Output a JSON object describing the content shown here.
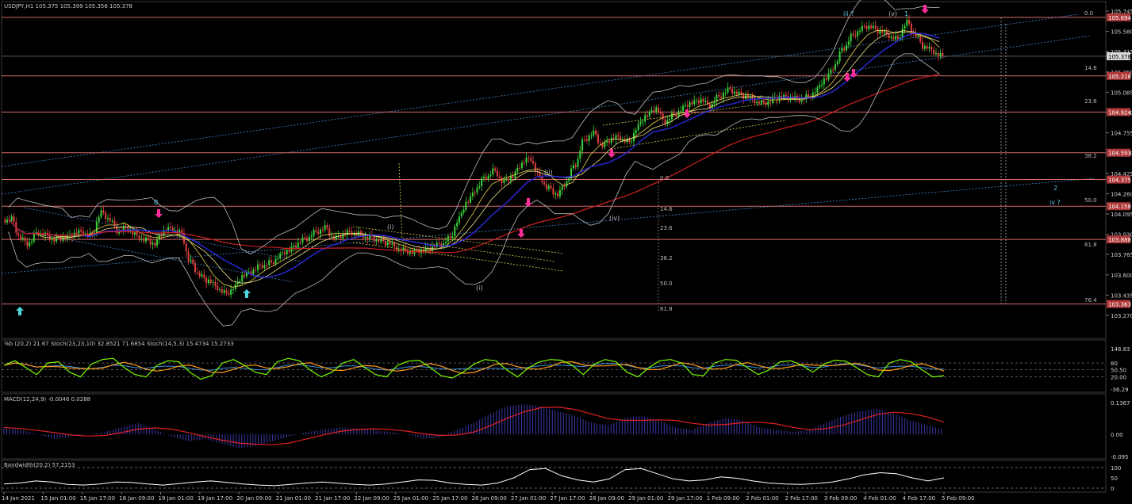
{
  "chart_data": [
    {
      "type": "line",
      "title": "USDJPY,H1  105.375 105.399 105.356 105.378",
      "symbol": "USDJPY,H1",
      "ohlc": [
        "105.375",
        "105.399",
        "105.356",
        "105.378"
      ],
      "ylim": [
        103.27,
        105.745
      ],
      "y_ticks": [
        "105.745",
        "105.580",
        "105.415",
        "105.250",
        "105.085",
        "104.920",
        "104.755",
        "104.590",
        "104.425",
        "104.260",
        "104.095",
        "103.930",
        "103.765",
        "103.600",
        "103.435",
        "103.270"
      ],
      "price_tags": [
        "105.694",
        "105.218",
        "104.924",
        "104.593",
        "104.375",
        "104.158",
        "103.888",
        "103.363"
      ],
      "current_price": "105.378",
      "x_ticks": [
        "14 Jan 2021",
        "15 Jan 01:00",
        "15 Jan 17:00",
        "18 Jan 09:00",
        "19 Jan 01:00",
        "19 Jan 17:00",
        "20 Jan 09:00",
        "21 Jan 01:00",
        "21 Jan 17:00",
        "22 Jan 09:00",
        "25 Jan 01:00",
        "25 Jan 17:00",
        "26 Jan 09:00",
        "27 Jan 01:00",
        "27 Jan 17:00",
        "28 Jan 09:00",
        "29 Jan 01:00",
        "29 Jan 17:00",
        "1 Feb 09:00",
        "2 Feb 01:00",
        "2 Feb 17:00",
        "3 Feb 09:00",
        "4 Feb 01:00",
        "4 Feb 17:00",
        "5 Feb 09:00"
      ],
      "close_series": [
        104.05,
        103.9,
        103.85,
        103.95,
        103.92,
        103.88,
        103.9,
        103.93,
        103.95,
        103.92,
        104.1,
        104.05,
        103.95,
        103.98,
        103.92,
        103.88,
        103.85,
        103.95,
        103.98,
        103.94,
        103.7,
        103.6,
        103.55,
        103.5,
        103.45,
        103.5,
        103.6,
        103.63,
        103.68,
        103.7,
        103.75,
        103.8,
        103.85,
        103.9,
        103.95,
        103.98,
        103.9,
        103.92,
        103.95,
        103.93,
        103.9,
        103.88,
        103.86,
        103.82,
        103.8,
        103.78,
        103.8,
        103.82,
        103.85,
        103.9,
        104.05,
        104.2,
        104.3,
        104.4,
        104.45,
        104.35,
        104.4,
        104.5,
        104.55,
        104.4,
        104.3,
        104.25,
        104.35,
        104.5,
        104.7,
        104.75,
        104.65,
        104.7,
        104.72,
        104.68,
        104.8,
        104.9,
        104.95,
        104.85,
        104.9,
        104.95,
        105.0,
        105.02,
        104.98,
        105.05,
        105.1,
        105.08,
        105.05,
        105.02,
        105.0,
        105.02,
        105.05,
        105.04,
        105.03,
        105.05,
        105.1,
        105.2,
        105.3,
        105.45,
        105.55,
        105.6,
        105.62,
        105.58,
        105.55,
        105.52,
        105.65,
        105.55,
        105.45,
        105.42,
        105.38
      ],
      "overlays": [
        "Moving average (blue)",
        "Moving average (red)",
        "Moving averages (yellow)",
        "Bollinger bands (white)"
      ],
      "fib_levels_right": [
        "0.0",
        "14.6",
        "23.6",
        "38.2",
        "50.0",
        "61.8",
        "76.4"
      ],
      "fib_levels_mid": [
        "0.0",
        "14.6",
        "23.6",
        "38.2",
        "50.0",
        "61.8"
      ],
      "wave_labels": [
        "iii ?",
        "(v)",
        "1",
        "(ii)",
        "(iv)",
        "(i)",
        "(i)",
        "B",
        "2",
        "iv ?"
      ]
    },
    {
      "type": "line",
      "title": "%b (20,2) 21.67  Stoch(23,23,10) 32.8521 71.6854  Stoch(14,5,3) 15.4734 15.2733",
      "y_ticks": [
        "148.83",
        "80",
        "50.50",
        "20.00",
        "-36.29"
      ],
      "series": [
        {
          "name": "%b (20,2)",
          "color": "#7cfc00"
        },
        {
          "name": "Stoch(23,23,10)",
          "color": "#ff9a1a"
        },
        {
          "name": "Stoch(14,5,3)",
          "color": "#3a8fd8"
        }
      ],
      "values_b": [
        70,
        90,
        60,
        30,
        80,
        85,
        40,
        20,
        75,
        95,
        100,
        60,
        30,
        20,
        70,
        90,
        85,
        40,
        10,
        25,
        80,
        95,
        70,
        40,
        30,
        85,
        100,
        90,
        50,
        20,
        40,
        80,
        95,
        60,
        30,
        20,
        70,
        88,
        92,
        60,
        25,
        15,
        40,
        75,
        95,
        90,
        50,
        20,
        60,
        85,
        95,
        92,
        70,
        30,
        75,
        95,
        85,
        40,
        20,
        60,
        90,
        95,
        80,
        30,
        25,
        80,
        95,
        92,
        60,
        30,
        50,
        85,
        90,
        70,
        40,
        75,
        92,
        88,
        60,
        30,
        20,
        80,
        95,
        85,
        50,
        20,
        25
      ]
    },
    {
      "type": "area",
      "title": "MACD(12,24,9) -0.0046 0.0288",
      "y_ticks": [
        "0.1367",
        "0.00",
        "-0.095"
      ],
      "series": [
        {
          "name": "MACD(12,24,9)",
          "color": "#3a3aa8"
        },
        {
          "name": "Signal",
          "color": "#e02020"
        }
      ],
      "values": [
        0.03,
        0.02,
        0.0,
        -0.02,
        -0.01,
        0.0,
        0.01,
        0.03,
        0.05,
        0.02,
        -0.01,
        -0.03,
        -0.02,
        -0.04,
        -0.06,
        -0.05,
        -0.03,
        -0.01,
        0.01,
        0.02,
        0.03,
        0.025,
        0.02,
        0.01,
        0.0,
        -0.02,
        -0.01,
        0.02,
        0.05,
        0.09,
        0.12,
        0.13,
        0.12,
        0.1,
        0.08,
        0.05,
        0.04,
        0.07,
        0.08,
        0.06,
        0.03,
        0.02,
        0.05,
        0.07,
        0.06,
        0.03,
        0.02,
        0.01,
        0.02,
        0.05,
        0.08,
        0.1,
        0.11,
        0.09,
        0.06,
        0.04,
        0.02
      ]
    },
    {
      "type": "line",
      "title": "Bandwidth(20,2) 57.2153",
      "y_ticks": [
        "100",
        "50",
        "0"
      ],
      "series": [
        {
          "name": "Bandwidth(20,2)",
          "color": "#ffffff"
        }
      ],
      "values": [
        20,
        25,
        35,
        30,
        18,
        15,
        20,
        30,
        28,
        20,
        15,
        22,
        30,
        35,
        28,
        20,
        15,
        12,
        18,
        25,
        30,
        24,
        18,
        15,
        20,
        30,
        40,
        38,
        25,
        18,
        15,
        25,
        50,
        90,
        95,
        60,
        40,
        30,
        45,
        90,
        95,
        70,
        45,
        35,
        40,
        55,
        48,
        35,
        25,
        20,
        18,
        22,
        30,
        45,
        65,
        75,
        70,
        50,
        35,
        50
      ]
    }
  ]
}
